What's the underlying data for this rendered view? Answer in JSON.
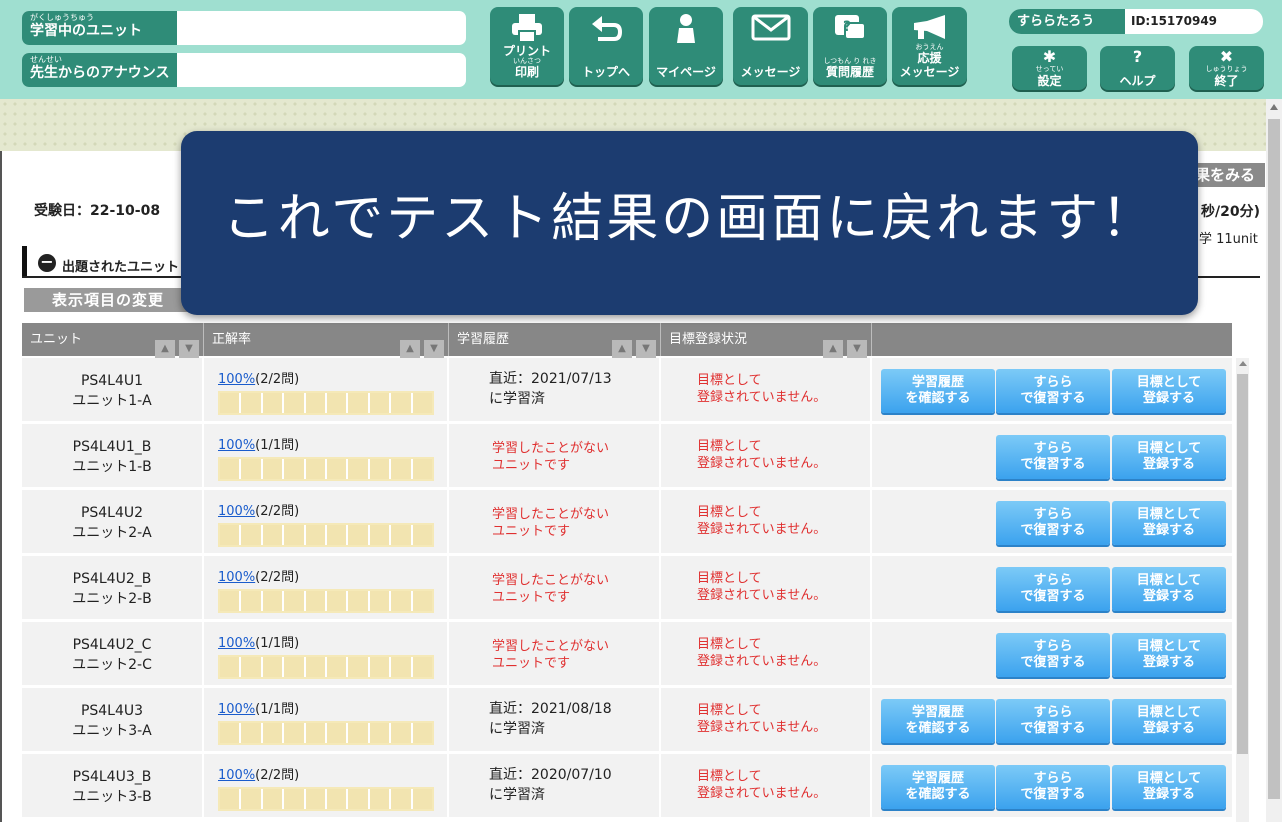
{
  "header": {
    "current_unit_label": "学習中のユニット",
    "current_unit_ruby": "がくしゅうちゅう",
    "current_unit_value": "",
    "announce_label": "先生からのアナウンス",
    "announce_ruby": "せんせい",
    "announce_value": "",
    "nav": [
      {
        "label": "プリント",
        "ruby": "いんさつ",
        "label2": "印刷",
        "icon": "printer-icon"
      },
      {
        "label": "トップへ",
        "icon": "return-icon"
      },
      {
        "label": "マイページ",
        "icon": "person-icon"
      },
      {
        "label": "メッセージ",
        "icon": "envelope-icon"
      },
      {
        "ruby": "しつもん り れき",
        "label": "質問履歴",
        "icon": "question-bubble-icon"
      },
      {
        "ruby": "おうえん",
        "label": "応援",
        "label2": "メッセージ",
        "icon": "megaphone-icon"
      }
    ],
    "user_name": "すららたろう",
    "user_id": "ID:15170949",
    "settings": {
      "ruby": "せってい",
      "label": "設定",
      "icon": "gear-icon",
      "glyph": "✱"
    },
    "help": {
      "label": "ヘルプ",
      "icon": "help-icon",
      "glyph": "?"
    },
    "exit": {
      "ruby": "しゅうりょう",
      "label": "終了",
      "icon": "close-icon",
      "glyph": "✖"
    }
  },
  "main": {
    "exam_date": "受験日：22-10-08",
    "see_result": "果をみる",
    "time_text": "秒/20分)",
    "unit_count": "学 11unit",
    "section_title": "出題されたユニット",
    "change_button": "表示項目の変更",
    "columns": [
      "ユニット",
      "正解率",
      "学習履歴",
      "目標登録状況"
    ],
    "sort_up": "▲",
    "sort_down": "▼",
    "rows": [
      {
        "code": "PS4L4U1",
        "name": "ユニット1-A",
        "rate": "100%",
        "count": "(2/2問)",
        "hist1": "直近：2021/07/13",
        "hist2": "に学習済",
        "hist_red": false,
        "goal1": "目標として",
        "goal2": "登録されていません。",
        "has_history_btn": true
      },
      {
        "code": "PS4L4U1_B",
        "name": "ユニット1-B",
        "rate": "100%",
        "count": "(1/1問)",
        "hist1": "学習したことがない",
        "hist2": "ユニットです",
        "hist_red": true,
        "goal1": "目標として",
        "goal2": "登録されていません。",
        "has_history_btn": false
      },
      {
        "code": "PS4L4U2",
        "name": "ユニット2-A",
        "rate": "100%",
        "count": "(2/2問)",
        "hist1": "学習したことがない",
        "hist2": "ユニットです",
        "hist_red": true,
        "goal1": "目標として",
        "goal2": "登録されていません。",
        "has_history_btn": false
      },
      {
        "code": "PS4L4U2_B",
        "name": "ユニット2-B",
        "rate": "100%",
        "count": "(2/2問)",
        "hist1": "学習したことがない",
        "hist2": "ユニットです",
        "hist_red": true,
        "goal1": "目標として",
        "goal2": "登録されていません。",
        "has_history_btn": false
      },
      {
        "code": "PS4L4U2_C",
        "name": "ユニット2-C",
        "rate": "100%",
        "count": "(1/1問)",
        "hist1": "学習したことがない",
        "hist2": "ユニットです",
        "hist_red": true,
        "goal1": "目標として",
        "goal2": "登録されていません。",
        "has_history_btn": false
      },
      {
        "code": "PS4L4U3",
        "name": "ユニット3-A",
        "rate": "100%",
        "count": "(1/1問)",
        "hist1": "直近：2021/08/18",
        "hist2": "に学習済",
        "hist_red": false,
        "goal1": "目標として",
        "goal2": "登録されていません。",
        "has_history_btn": true
      },
      {
        "code": "PS4L4U3_B",
        "name": "ユニット3-B",
        "rate": "100%",
        "count": "(2/2問)",
        "hist1": "直近：2020/07/10",
        "hist2": "に学習済",
        "hist_red": false,
        "goal1": "目標として",
        "goal2": "登録されていません。",
        "has_history_btn": true
      }
    ],
    "btn_history": [
      "学習履歴",
      "を確認する"
    ],
    "btn_review": [
      "すらら",
      "で復習する"
    ],
    "btn_goal": [
      "目標として",
      "登録する"
    ]
  },
  "overlay": {
    "text": "これでテスト結果の画面に戻れます！"
  },
  "colors": {
    "header_bg": "#9fdfd0",
    "accent": "#2f8c78",
    "overlay_bg": "#1c3c70",
    "action_button": "#3ba2ee",
    "warning_text": "#e03030"
  }
}
